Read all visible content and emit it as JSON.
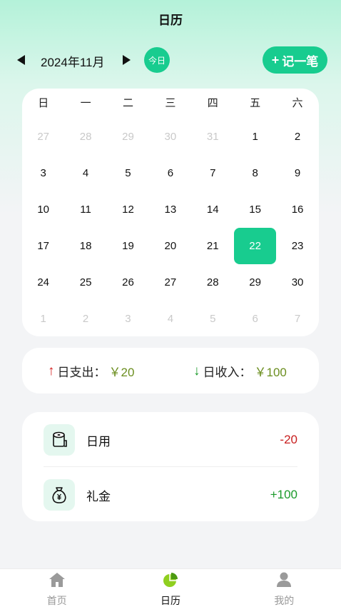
{
  "header": {
    "title": "日历"
  },
  "month_bar": {
    "month": "2024年11月",
    "today_label": "今日",
    "add_label": "记一笔",
    "add_plus": "+"
  },
  "calendar": {
    "weekdays": [
      "日",
      "一",
      "二",
      "三",
      "四",
      "五",
      "六"
    ],
    "days": [
      {
        "d": "27",
        "muted": true
      },
      {
        "d": "28",
        "muted": true
      },
      {
        "d": "29",
        "muted": true
      },
      {
        "d": "30",
        "muted": true
      },
      {
        "d": "31",
        "muted": true
      },
      {
        "d": "1"
      },
      {
        "d": "2"
      },
      {
        "d": "3"
      },
      {
        "d": "4"
      },
      {
        "d": "5"
      },
      {
        "d": "6"
      },
      {
        "d": "7"
      },
      {
        "d": "8"
      },
      {
        "d": "9"
      },
      {
        "d": "10"
      },
      {
        "d": "11"
      },
      {
        "d": "12"
      },
      {
        "d": "13"
      },
      {
        "d": "14"
      },
      {
        "d": "15"
      },
      {
        "d": "16"
      },
      {
        "d": "17"
      },
      {
        "d": "18"
      },
      {
        "d": "19"
      },
      {
        "d": "20"
      },
      {
        "d": "21"
      },
      {
        "d": "22",
        "selected": true
      },
      {
        "d": "23"
      },
      {
        "d": "24"
      },
      {
        "d": "25"
      },
      {
        "d": "26"
      },
      {
        "d": "27"
      },
      {
        "d": "28"
      },
      {
        "d": "29"
      },
      {
        "d": "30"
      },
      {
        "d": "1",
        "muted": true
      },
      {
        "d": "2",
        "muted": true
      },
      {
        "d": "3",
        "muted": true
      },
      {
        "d": "4",
        "muted": true
      },
      {
        "d": "5",
        "muted": true
      },
      {
        "d": "6",
        "muted": true
      },
      {
        "d": "7",
        "muted": true
      }
    ]
  },
  "summary": {
    "expense_label": "日支出：",
    "expense_value": "￥20",
    "income_label": "日收入：",
    "income_value": "￥100",
    "up_arrow": "↑",
    "down_arrow": "↓"
  },
  "records": [
    {
      "name": "日用",
      "amount": "-20",
      "icon": "toilet-paper-icon"
    },
    {
      "name": "礼金",
      "amount": "+100",
      "icon": "money-bag-icon"
    }
  ],
  "tabs": [
    {
      "label": "首页",
      "icon": "home-icon"
    },
    {
      "label": "日历",
      "icon": "pie-chart-icon",
      "active": true
    },
    {
      "label": "我的",
      "icon": "user-icon"
    }
  ],
  "colors": {
    "accent": "#18cc8f",
    "expense": "#c81e1e",
    "income": "#1a9a2a",
    "amount": "#6b8e1f"
  }
}
